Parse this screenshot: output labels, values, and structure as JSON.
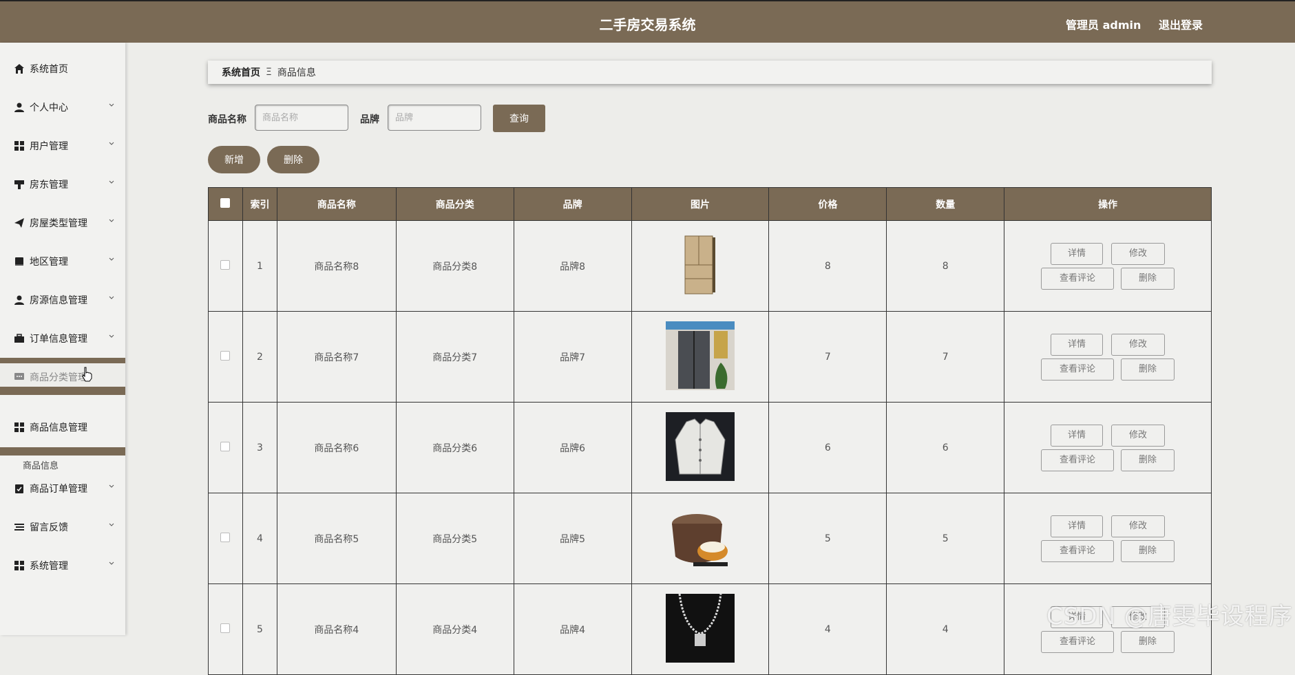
{
  "header": {
    "title": "二手房交易系统",
    "user": "管理员 admin",
    "logout": "退出登录"
  },
  "sidebar": {
    "items": [
      {
        "label": "系统首页",
        "icon": "home-icon"
      },
      {
        "label": "个人中心",
        "icon": "user-icon"
      },
      {
        "label": "用户管理",
        "icon": "grid-icon"
      },
      {
        "label": "房东管理",
        "icon": "brush-icon"
      },
      {
        "label": "房屋类型管理",
        "icon": "send-icon"
      },
      {
        "label": "地区管理",
        "icon": "book-icon"
      },
      {
        "label": "房源信息管理",
        "icon": "user-icon"
      },
      {
        "label": "订单信息管理",
        "icon": "briefcase-icon"
      },
      {
        "label": "商品分类管理",
        "icon": "chat-icon"
      },
      {
        "label": "商品信息管理",
        "icon": "grid-icon"
      },
      {
        "label": "商品订单管理",
        "icon": "clipboard-icon"
      },
      {
        "label": "留言反馈",
        "icon": "list-icon"
      },
      {
        "label": "系统管理",
        "icon": "grid-icon"
      }
    ],
    "sub_item": "商品信息"
  },
  "breadcrumb": {
    "home": "系统首页",
    "sep": "Ξ",
    "current": "商品信息"
  },
  "search": {
    "name_label": "商品名称",
    "name_placeholder": "商品名称",
    "brand_label": "品牌",
    "brand_placeholder": "品牌",
    "query_button": "查询"
  },
  "actions": {
    "add": "新增",
    "delete": "删除"
  },
  "table": {
    "columns": [
      "索引",
      "商品名称",
      "商品分类",
      "品牌",
      "图片",
      "价格",
      "数量",
      "操作"
    ],
    "rows": [
      {
        "index": "1",
        "name": "商品名称8",
        "category": "商品分类8",
        "brand": "品牌8",
        "image": "refrigerator-gold",
        "price": "8",
        "qty": "8"
      },
      {
        "index": "2",
        "name": "商品名称7",
        "category": "商品分类7",
        "brand": "品牌7",
        "image": "refrigerator-silver",
        "price": "7",
        "qty": "7"
      },
      {
        "index": "3",
        "name": "商品名称6",
        "category": "商品分类6",
        "brand": "品牌6",
        "image": "jacket",
        "price": "6",
        "qty": "6"
      },
      {
        "index": "4",
        "name": "商品名称5",
        "category": "商品分类5",
        "brand": "品牌5",
        "image": "rice-cooker",
        "price": "5",
        "qty": "5"
      },
      {
        "index": "5",
        "name": "商品名称4",
        "category": "商品分类4",
        "brand": "品牌4",
        "image": "necklace",
        "price": "4",
        "qty": "4"
      }
    ],
    "ops": {
      "detail": "详情",
      "edit": "修改",
      "comments": "查看评论",
      "delete": "删除"
    }
  },
  "watermark": "CSDN @唐雯毕设程序",
  "colors": {
    "brand": "#7a6a55",
    "background": "#ededea",
    "sidebar": "#f2f2f0"
  }
}
